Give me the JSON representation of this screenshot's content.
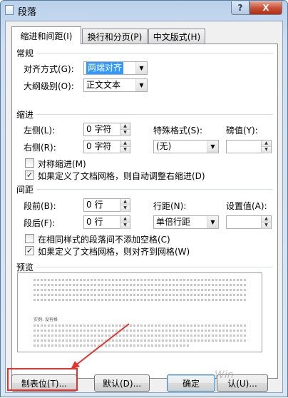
{
  "window": {
    "title": "段落",
    "help_label": "?",
    "close_label": "X"
  },
  "tabs": [
    {
      "label": "缩进和间距(I)",
      "active": true
    },
    {
      "label": "换行和分页(P)",
      "active": false
    },
    {
      "label": "中文版式(H)",
      "active": false
    }
  ],
  "general": {
    "heading": "常规",
    "alignment_label": "对齐方式(G):",
    "alignment_value": "两端对齐",
    "outline_label": "大纲级别(O):",
    "outline_value": "正文文本"
  },
  "indent": {
    "heading": "缩进",
    "left_label": "左侧(L):",
    "left_value": "0 字符",
    "right_label": "右侧(R):",
    "right_value": "0 字符",
    "special_label": "特殊格式(S):",
    "special_value": "(无)",
    "by_label": "磅值(Y):",
    "by_value": "",
    "mirror_label": "对称缩进(M)",
    "mirror_checked": false,
    "auto_adjust_label": "如果定义了文档网格，则自动调整右缩进(D)",
    "auto_adjust_checked": true
  },
  "spacing": {
    "heading": "间距",
    "before_label": "段前(B):",
    "before_value": "0 行",
    "after_label": "段后(F):",
    "after_value": "0 行",
    "line_label": "行距(N):",
    "line_value": "单倍行距",
    "at_label": "设置值(A):",
    "at_value": "",
    "no_space_label": "在相同样式的段落间不添加空格(C)",
    "no_space_checked": false,
    "snap_grid_label": "如果定义了文档网格，则对齐到网格(W)",
    "snap_grid_checked": true
  },
  "preview": {
    "heading": "预览",
    "sample_text": "实例: 没有格"
  },
  "buttons": {
    "tabs_label": "制表位(T)...",
    "default_label": "默认(D)...",
    "ok_label": "确定",
    "cancel_label": "认(U)..."
  },
  "watermark_text": "Win"
}
